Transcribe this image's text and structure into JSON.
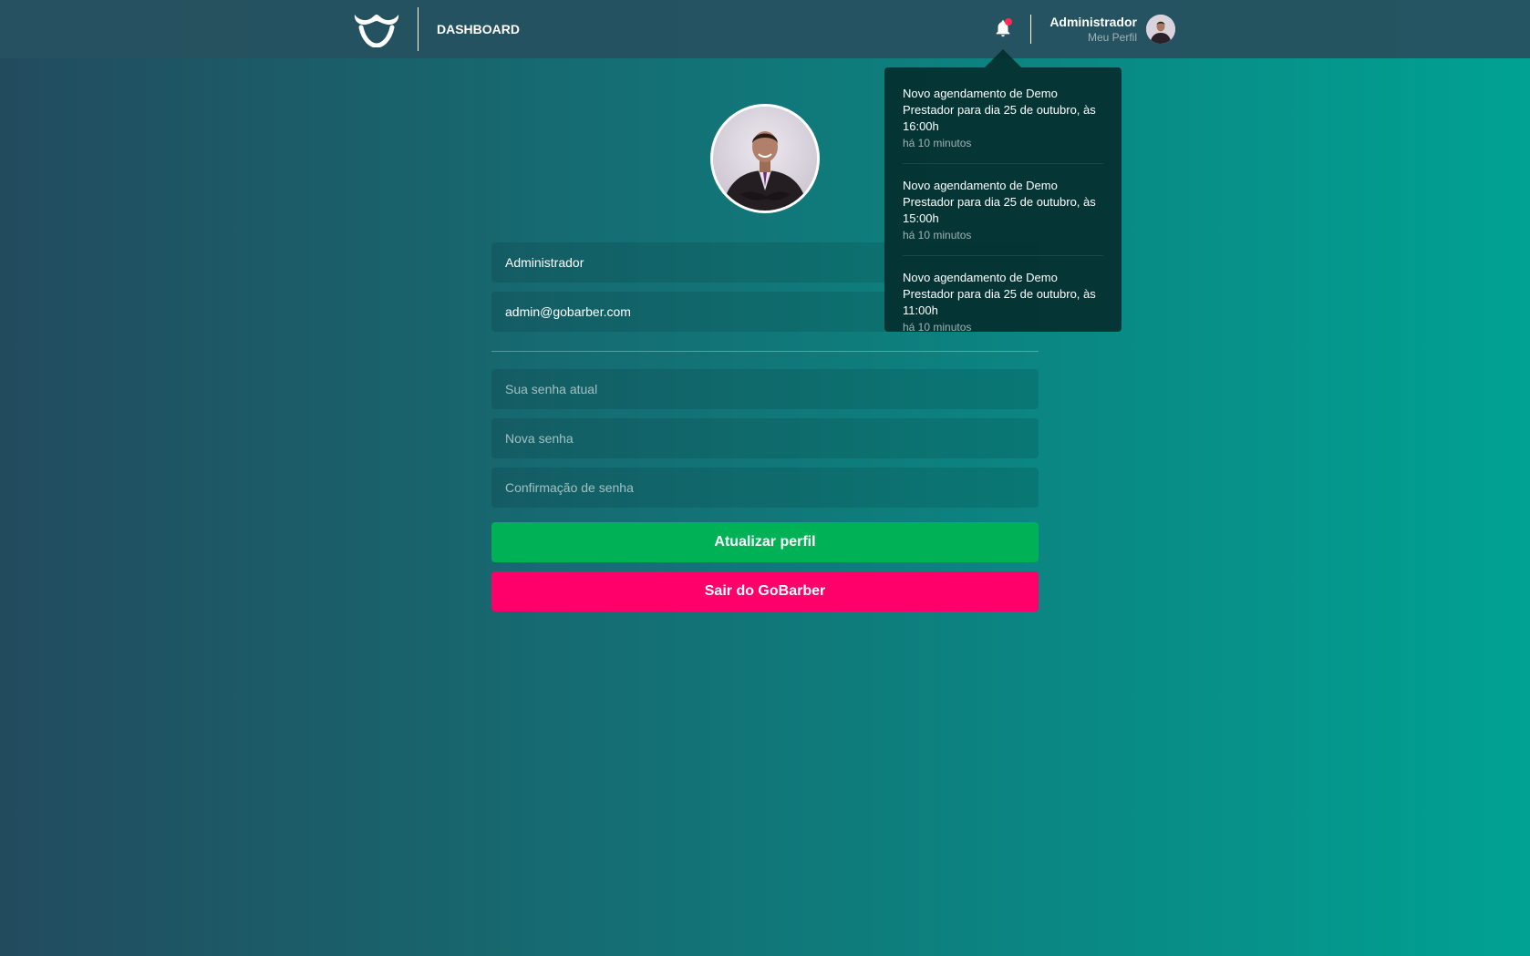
{
  "header": {
    "nav_label": "DASHBOARD",
    "profile_name": "Administrador",
    "profile_link": "Meu Perfil"
  },
  "notifications": [
    {
      "text": "Novo agendamento de Demo Prestador para dia 25 de outubro, às 16:00h",
      "time": "há 10 minutos"
    },
    {
      "text": "Novo agendamento de Demo Prestador para dia 25 de outubro, às 15:00h",
      "time": "há 10 minutos"
    },
    {
      "text": "Novo agendamento de Demo Prestador para dia 25 de outubro, às 11:00h",
      "time": "há 10 minutos"
    }
  ],
  "form": {
    "name_value": "Administrador",
    "email_value": "admin@gobarber.com",
    "old_password_placeholder": "Sua senha atual",
    "new_password_placeholder": "Nova senha",
    "confirm_password_placeholder": "Confirmação de senha",
    "update_label": "Atualizar perfil",
    "logout_label": "Sair do GoBarber"
  },
  "colors": {
    "update_button": "#00b155",
    "logout_button": "#ff006b",
    "notification_dot": "#ff2d55"
  },
  "icons": {
    "logo": "mustache-logo-icon",
    "notifications": "bell-icon"
  }
}
